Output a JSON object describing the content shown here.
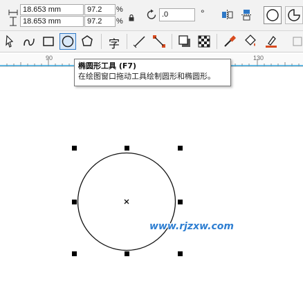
{
  "property_bar": {
    "width_value": "18.653 mm",
    "height_value": "18.653 mm",
    "scale_x": "97.2",
    "scale_y": "97.2",
    "percent_unit": "%",
    "rotation_value": ".0",
    "degree_symbol": "°"
  },
  "toolbar": {
    "text_tool_glyph": "字",
    "active_tool": "ellipse"
  },
  "ruler": {
    "labels": [
      "90",
      "130"
    ]
  },
  "tooltip": {
    "title": "椭圆形工具 (F7)",
    "description": "在绘图窗口拖动工具绘制圆形和椭圆形。"
  },
  "watermark": {
    "text": "www.rjzxw.com"
  },
  "colors": {
    "accent": "#2e78c6",
    "watermark": "#2f7fd2",
    "ruler_line": "#2ea0d8"
  }
}
